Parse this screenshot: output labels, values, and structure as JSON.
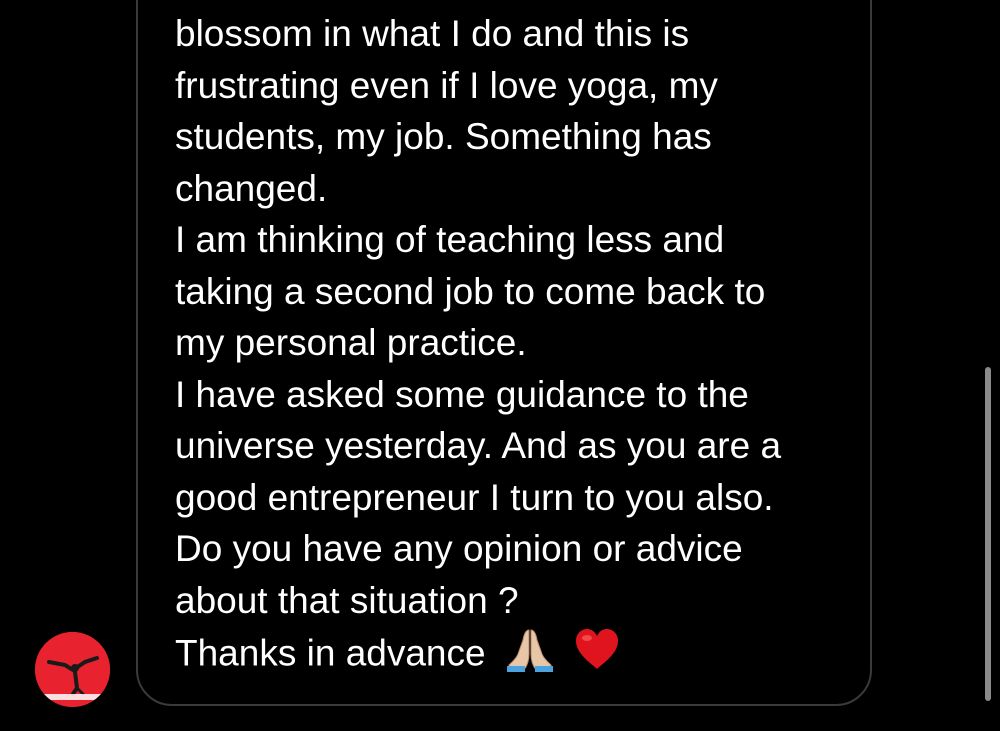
{
  "message": {
    "lines": [
      "blossom in what I do and this is",
      "frustrating even if I love yoga, my",
      "students, my job. Something has",
      "changed.",
      "I am thinking of teaching less and",
      "taking a second job to come back to",
      "my personal practice.",
      "I have asked some guidance to the",
      "universe yesterday. And as you are a",
      "good entrepreneur I turn to you also.",
      "Do you have any opinion or advice",
      "about that situation ?",
      "Thanks in advance"
    ],
    "emojis": [
      "folded-hands-icon",
      "red-heart-icon"
    ]
  },
  "colors": {
    "background": "#000000",
    "text": "#ffffff",
    "bubble_border": "#3a3a3a",
    "avatar_bg": "#e8232f",
    "heart": "#e0141e",
    "scrollbar": "#8a8a8a"
  }
}
